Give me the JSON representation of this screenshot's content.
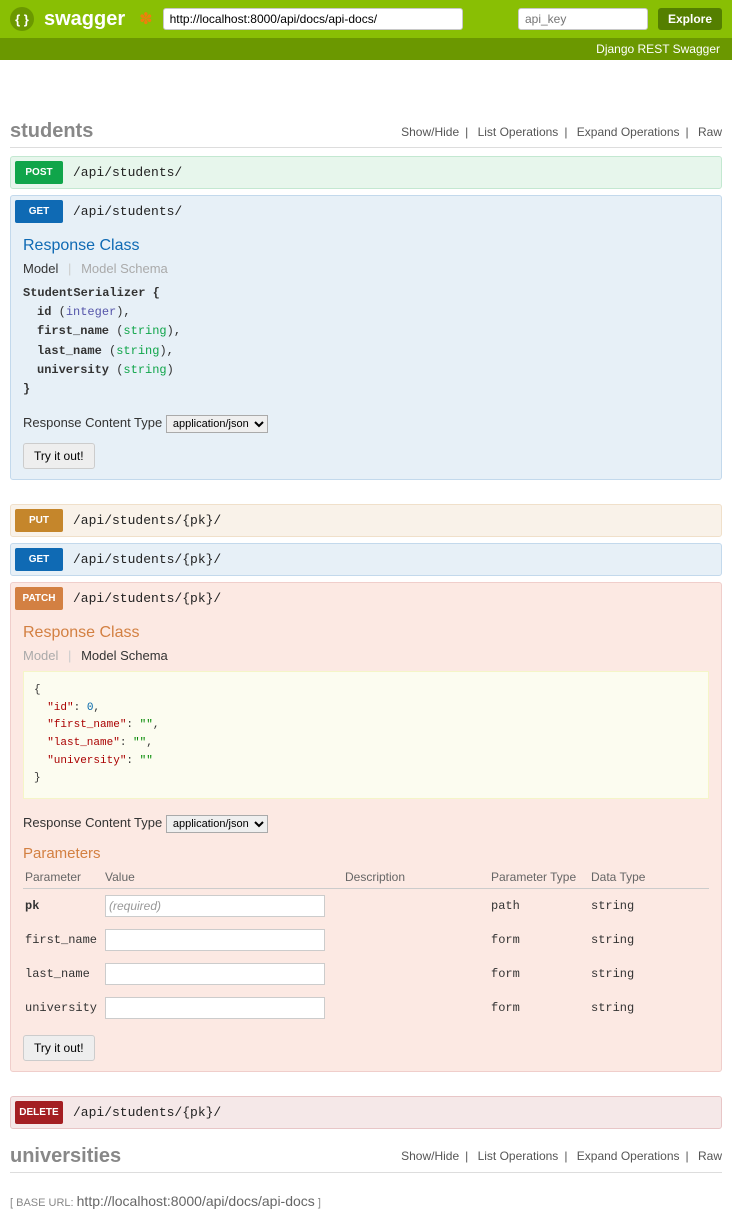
{
  "header": {
    "brand": "swagger",
    "url": "http://localhost:8000/api/docs/api-docs/",
    "apikey_placeholder": "api_key",
    "explore": "Explore",
    "subtitle": "Django REST Swagger"
  },
  "section_links": {
    "showhide": "Show/Hide",
    "list": "List Operations",
    "expand": "Expand Operations",
    "raw": "Raw"
  },
  "students": {
    "title": "students",
    "post_path": "/api/students/",
    "get_path": "/api/students/",
    "put_path": "/api/students/{pk}/",
    "get_pk_path": "/api/students/{pk}/",
    "patch_path": "/api/students/{pk}/",
    "delete_path": "/api/students/{pk}/"
  },
  "labels": {
    "post": "POST",
    "get": "GET",
    "put": "PUT",
    "patch": "PATCH",
    "delete": "DELETE",
    "response_class": "Response Class",
    "model": "Model",
    "model_schema": "Model Schema",
    "rct": "Response Content Type",
    "try": "Try it out!",
    "parameters": "Parameters",
    "th_param": "Parameter",
    "th_value": "Value",
    "th_desc": "Description",
    "th_ptype": "Parameter Type",
    "th_dtype": "Data Type"
  },
  "content_type": {
    "option": "application/json"
  },
  "get_body": {
    "serializer": "StudentSerializer {",
    "fields": [
      {
        "name": "id",
        "type": "integer"
      },
      {
        "name": "first_name",
        "type": "string"
      },
      {
        "name": "last_name",
        "type": "string"
      },
      {
        "name": "university",
        "type": "string"
      }
    ],
    "close": "}"
  },
  "patch_body": {
    "schema_json": {
      "id": 0,
      "first_name": "",
      "last_name": "",
      "university": ""
    },
    "params": [
      {
        "name": "pk",
        "placeholder": "(required)",
        "ptype": "path",
        "dtype": "string",
        "required": true
      },
      {
        "name": "first_name",
        "placeholder": "",
        "ptype": "form",
        "dtype": "string"
      },
      {
        "name": "last_name",
        "placeholder": "",
        "ptype": "form",
        "dtype": "string"
      },
      {
        "name": "university",
        "placeholder": "",
        "ptype": "form",
        "dtype": "string"
      }
    ]
  },
  "universities": {
    "title": "universities"
  },
  "base_url": {
    "label": "[ BASE URL:",
    "value": "http://localhost:8000/api/docs/api-docs",
    "close": "]"
  }
}
